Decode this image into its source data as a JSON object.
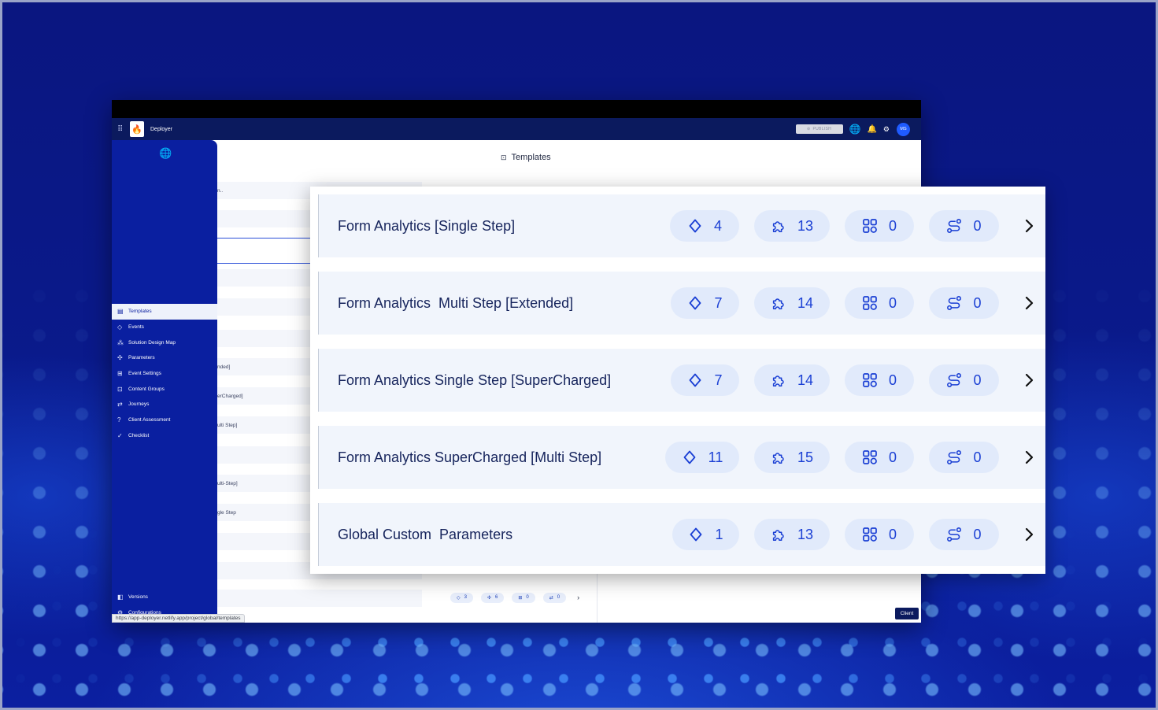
{
  "app": {
    "name": "Deployer",
    "publish_label": "PUBLISH",
    "avatar_initials": "MS",
    "page_title": "Templates",
    "status_url": "https://app-deployer.netlify.app/project/global/templates",
    "client_button": "Client"
  },
  "sidebar": {
    "items": [
      {
        "label": "Templates",
        "icon": "template-icon"
      },
      {
        "label": "Events",
        "icon": "diamond-icon"
      },
      {
        "label": "Solution Design Map",
        "icon": "map-icon"
      },
      {
        "label": "Parameters",
        "icon": "puzzle-icon"
      },
      {
        "label": "Event Settings",
        "icon": "settings-grid-icon"
      },
      {
        "label": "Content Groups",
        "icon": "content-groups-icon"
      },
      {
        "label": "Journeys",
        "icon": "route-icon"
      },
      {
        "label": "Client Assessment",
        "icon": "question-icon"
      },
      {
        "label": "Checklist",
        "icon": "check-icon"
      }
    ],
    "bottom": [
      {
        "label": "Versions",
        "icon": "versions-icon"
      },
      {
        "label": "Configurations",
        "icon": "gear-icon"
      }
    ]
  },
  "background_list": {
    "fragments": [
      "n..",
      "nded]",
      "erCharged]",
      "ulti Step]",
      "ulti-Step]",
      "gle Step"
    ],
    "bottom_chips": {
      "events": "3",
      "parameters": "6",
      "content_groups": "0",
      "journeys": "0"
    }
  },
  "templates": [
    {
      "title": "Form Analytics [Single Step]",
      "events": "4",
      "parameters": "13",
      "content_groups": "0",
      "journeys": "0"
    },
    {
      "title": "Form Analytics  Multi Step [Extended]",
      "events": "7",
      "parameters": "14",
      "content_groups": "0",
      "journeys": "0"
    },
    {
      "title": "Form Analytics Single Step [SuperCharged]",
      "events": "7",
      "parameters": "14",
      "content_groups": "0",
      "journeys": "0"
    },
    {
      "title": "Form Analytics SuperCharged [Multi Step]",
      "events": "11",
      "parameters": "15",
      "content_groups": "0",
      "journeys": "0"
    },
    {
      "title": "Global Custom  Parameters",
      "events": "1",
      "parameters": "13",
      "content_groups": "0",
      "journeys": "0"
    }
  ],
  "colors": {
    "accent": "#1a3fd4",
    "sidebar": "#0a1fa0",
    "header": "#0b1a5e",
    "chip_bg": "#e1eafb",
    "row_bg": "#f1f5fc"
  }
}
